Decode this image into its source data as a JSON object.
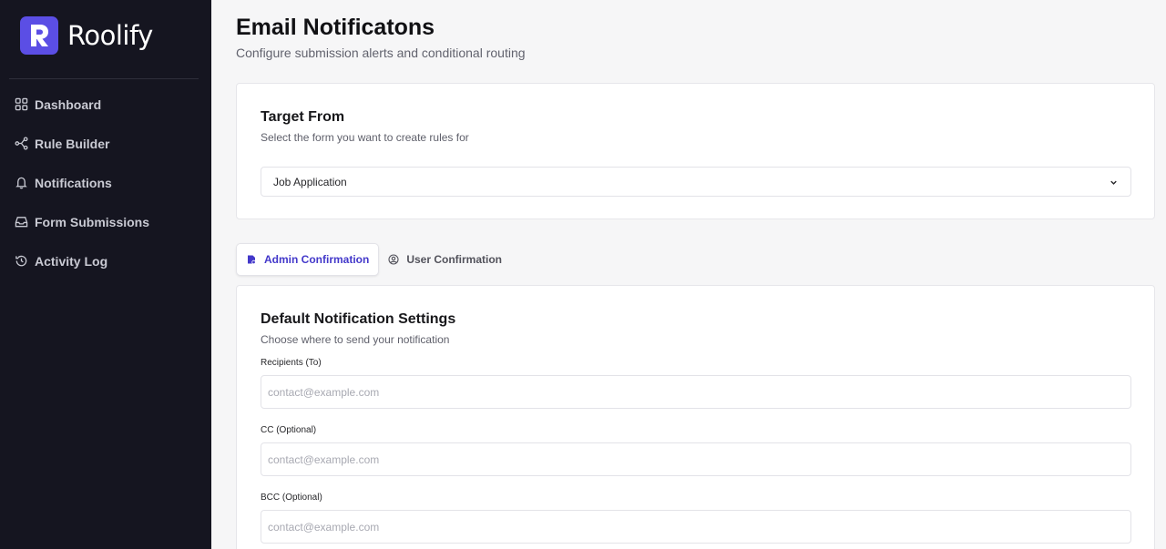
{
  "app": {
    "name": "Roolify",
    "logo_letter": "R",
    "brand_color": "#5b4ee5"
  },
  "sidebar": {
    "items": [
      {
        "label": "Dashboard",
        "icon": "dashboard-icon"
      },
      {
        "label": "Rule Builder",
        "icon": "rule-builder-icon"
      },
      {
        "label": "Notifications",
        "icon": "bell-icon"
      },
      {
        "label": "Form Submissions",
        "icon": "inbox-icon"
      },
      {
        "label": "Activity Log",
        "icon": "history-icon"
      }
    ]
  },
  "header": {
    "title": "Email Notificatons",
    "subtitle": "Configure submission alerts and conditional routing"
  },
  "target_form": {
    "title": "Target From",
    "description": "Select the form you want to create rules for",
    "selected": "Job Application"
  },
  "tabs": [
    {
      "label": "Admin Confirmation",
      "active": true,
      "icon": "admin-icon"
    },
    {
      "label": "User Confirmation",
      "active": false,
      "icon": "user-circle-icon"
    }
  ],
  "settings": {
    "title": "Default Notification Settings",
    "description": "Choose where to send your notification",
    "fields": [
      {
        "label": "Recipients (To)",
        "placeholder": "contact@example.com",
        "value": ""
      },
      {
        "label": "CC (Optional)",
        "placeholder": "contact@example.com",
        "value": ""
      },
      {
        "label": "BCC (Optional)",
        "placeholder": "contact@example.com",
        "value": ""
      }
    ]
  }
}
